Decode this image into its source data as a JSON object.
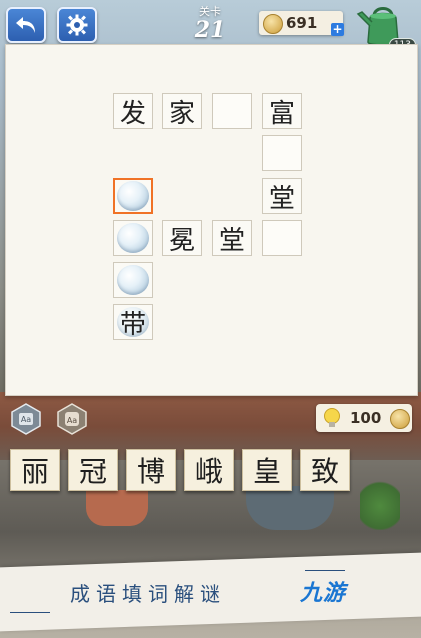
{
  "header": {
    "level_label": "关卡",
    "level_number": "21",
    "coins": "691",
    "coin_plus": "+",
    "water_badge": "113"
  },
  "board": {
    "cells": [
      {
        "id": "r0c0",
        "text": "发"
      },
      {
        "id": "r0c1",
        "text": "家"
      },
      {
        "id": "r0c2",
        "text": ""
      },
      {
        "id": "r0c3",
        "text": "富"
      },
      {
        "id": "r1c3",
        "text": ""
      },
      {
        "id": "r2c3",
        "text": "堂"
      },
      {
        "id": "r3c1",
        "text": "冕"
      },
      {
        "id": "r3c2",
        "text": "堂"
      },
      {
        "id": "r3c3",
        "text": ""
      },
      {
        "id": "r5c0",
        "text": "带"
      }
    ]
  },
  "tools": {
    "hint_count": "100"
  },
  "candidates": [
    "丽",
    "冠",
    "博",
    "峨",
    "皇",
    "致"
  ],
  "footer": {
    "title": "成语填词解谜",
    "brand": "九游"
  },
  "colors": {
    "accent_selected": "#f07226",
    "button_blue": "#2d5fb0",
    "footer_text": "#2a4f7d",
    "brand_blue": "#1a76d2"
  }
}
